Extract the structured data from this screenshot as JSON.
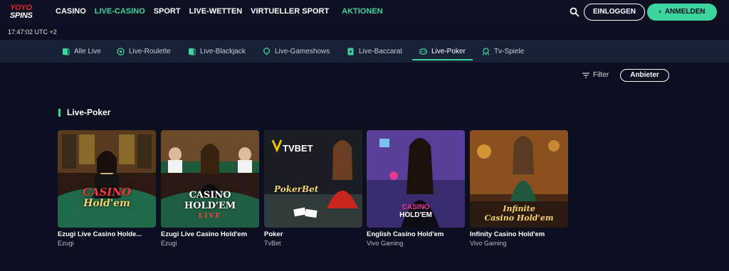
{
  "brand": {
    "line1": "YOYO",
    "line2": "SPINS"
  },
  "nav": [
    {
      "label": "CASINO",
      "active": false
    },
    {
      "label": "LIVE-CASINO",
      "active": true
    },
    {
      "label": "SPORT",
      "active": false
    },
    {
      "label": "LIVE-WETTEN",
      "active": false
    },
    {
      "label": "VIRTUELLER SPORT",
      "active": false
    },
    {
      "label": "AKTIONEN",
      "active": false
    }
  ],
  "header": {
    "login_label": "EINLOGGEN",
    "register_label": "ANMELDEN",
    "search_icon": "search-icon"
  },
  "clock": "17:47:02 UTC +2",
  "categories": [
    {
      "label": "Alle Live",
      "icon": "cards-icon"
    },
    {
      "label": "Live-Roulette",
      "icon": "roulette-icon"
    },
    {
      "label": "Live-Blackjack",
      "icon": "blackjack-icon"
    },
    {
      "label": "Live-Gameshows",
      "icon": "gameshow-icon"
    },
    {
      "label": "Live-Baccarat",
      "icon": "baccarat-icon"
    },
    {
      "label": "Live-Poker",
      "icon": "poker-icon",
      "active": true
    },
    {
      "label": "Tv-Spiele",
      "icon": "tv-games-icon"
    }
  ],
  "filter_label": "Filter",
  "provider_label": "Anbieter",
  "section_title": "Live-Poker",
  "games": [
    {
      "name": "Ezugi Live Casino Holde...",
      "provider": "Ezugi",
      "logo_line1": "CASINO",
      "logo_line2": "Hold'em"
    },
    {
      "name": "Ezugi Live Casino Hold'em",
      "provider": "Ezugi",
      "logo_line1": "CASINO",
      "logo_line2": "HOLD'EM",
      "logo_line3": "LIVE"
    },
    {
      "name": "Poker",
      "provider": "TvBet",
      "logo_line1": "TVBET",
      "logo_line2": "PokerBet"
    },
    {
      "name": "English Casino Hold'em",
      "provider": "Vivo Gaming",
      "logo_line1": "CASINO",
      "logo_line2": "HOLD'EM"
    },
    {
      "name": "Infinity Casino Hold'em",
      "provider": "Vivo Gaming",
      "logo_line1": "Infinite",
      "logo_line2": "Casino Hold'em"
    }
  ],
  "colors": {
    "accent": "#3ed49d",
    "background": "#0b0f1f",
    "catbar": "#182236",
    "brand_red": "#e2262f"
  }
}
